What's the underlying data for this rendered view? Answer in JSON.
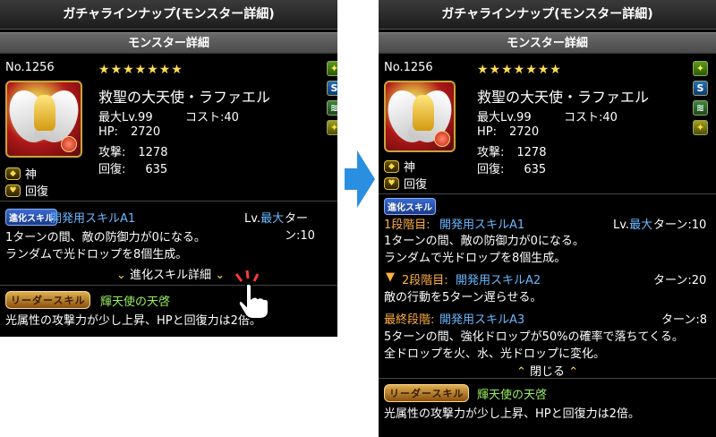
{
  "window_title": "ガチャラインナップ(モンスター詳細)",
  "subheader": "モンスター詳細",
  "monster": {
    "number": "No.1256",
    "stars": "★★★★★★★",
    "name": "救聖の大天使・ラファエル",
    "max_lv": "最大Lv.99",
    "cost": "コスト:40",
    "hp_label": "HP:",
    "hp_value": "2720",
    "atk_label": "攻撃:",
    "atk_value": "1278",
    "rcv_label": "回復:",
    "rcv_value": "635",
    "type1": "神",
    "type2": "回復"
  },
  "awakenings": [
    "skill-boost-icon",
    "skill-charge-icon",
    "bind-resist-icon",
    "skill-boost-plus-icon"
  ],
  "left": {
    "skill_badge": "進化スキル",
    "skill_name": "開発用スキルA1",
    "lv_prefix": "Lv.",
    "lv_max": "最大",
    "turn": "ターン:10",
    "desc1": "1ターンの間、敵の防御力が0になる。",
    "desc2": "ランダムで光ドロップを8個生成。",
    "expand_label": "進化スキル詳細",
    "leader_badge": "リーダースキル",
    "leader_name": "輝天使の天啓",
    "leader_desc": "光属性の攻撃力が少し上昇、HPと回復力は2倍。"
  },
  "right": {
    "skill_badge": "進化スキル",
    "stage1_label": "1段階目:",
    "stage1_name": "開発用スキルA1",
    "lv_prefix": "Lv.",
    "lv_max": "最大",
    "turn1": "ターン:10",
    "stage1_desc1": "1ターンの間、敵の防御力が0になる。",
    "stage1_desc2": "ランダムで光ドロップを8個生成。",
    "stage2_label": "2段階目:",
    "stage2_name": "開発用スキルA2",
    "turn2": "ターン:20",
    "stage2_desc": "敵の行動を5ターン遅らせる。",
    "final_label": "最終段階:",
    "final_name": "開発用スキルA3",
    "turn3": "ターン:8",
    "final_desc1": "5ターンの間、強化ドロップが50%の確率で落ちてくる。",
    "final_desc2": "全ドロップを火、水、光ドロップに変化。",
    "collapse_label": "閉じる",
    "leader_badge": "リーダースキル",
    "leader_name": "輝天使の天啓",
    "leader_desc": "光属性の攻撃力が少し上昇、HPと回復力は2倍。"
  },
  "colors": {
    "arrow": "#2a8fe0",
    "skill_name": "#6ab8ff",
    "leader_name": "#9af060",
    "accent_gold": "#ffd94a"
  }
}
